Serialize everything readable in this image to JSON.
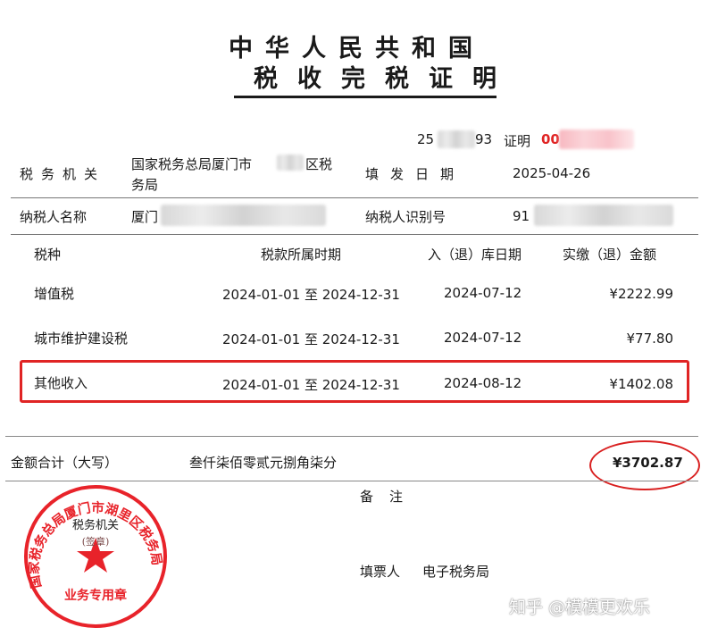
{
  "header": {
    "title_line1": "中华人民共和国",
    "title_line2": "税收完税证明"
  },
  "serial": {
    "prefix": "25",
    "suffix": "93",
    "label": "证明",
    "code_prefix": "00"
  },
  "meta": {
    "tax_authority_label": "税务机关",
    "tax_authority_line1": "国家税务总局厦门市",
    "tax_authority_line1_suffix": "区税",
    "tax_authority_line2": "务局",
    "issue_date_label": "填发日期",
    "issue_date": "2025-04-26",
    "taxpayer_name_label": "纳税人名称",
    "taxpayer_name_prefix": "厦门",
    "taxpayer_id_label": "纳税人识别号",
    "taxpayer_id_prefix": "91"
  },
  "table": {
    "headers": [
      "税种",
      "税款所属时期",
      "入（退）库日期",
      "实缴（退）金额"
    ],
    "rows": [
      {
        "tax_type": "增值税",
        "period": "2024-01-01 至 2024-12-31",
        "date": "2024-07-12",
        "amount": "¥2222.99",
        "highlighted": false
      },
      {
        "tax_type": "城市维护建设税",
        "period": "2024-01-01 至 2024-12-31",
        "date": "2024-07-12",
        "amount": "¥77.80",
        "highlighted": false
      },
      {
        "tax_type": "其他收入",
        "period": "2024-01-01 至 2024-12-31",
        "date": "2024-08-12",
        "amount": "¥1402.08",
        "highlighted": true
      }
    ]
  },
  "total": {
    "label": "金额合计（大写）",
    "uppercase": "叁仟柒佰零贰元捌角柒分",
    "amount": "¥3702.87"
  },
  "remarks_label": "备注",
  "issuer_label": "填票人",
  "issuer_value": "电子税务局",
  "seal": {
    "outer_text": "国家税务总局厦门市湖里区税务局",
    "center_top": "税务机关",
    "center_sub": "(签章)",
    "bottom": "业务专用章",
    "color": "#e8232a"
  },
  "watermark": "知乎 @模模更欢乐",
  "colors": {
    "highlight_red": "#e02424",
    "seal_red": "#e8232a"
  }
}
